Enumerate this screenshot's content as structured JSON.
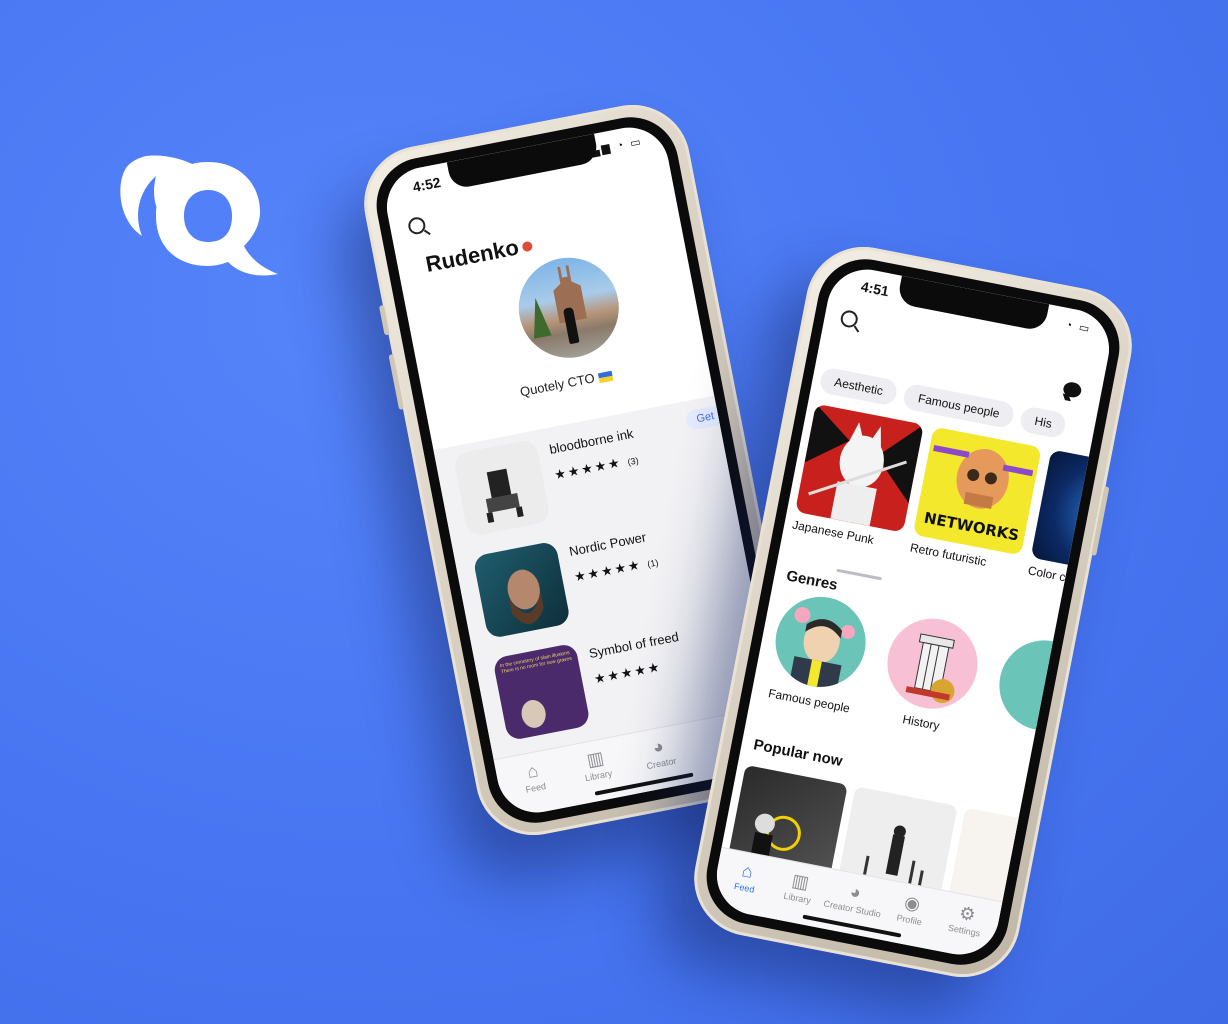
{
  "brand": {
    "logo_letter": "Q",
    "logo_icon": "feather-icon",
    "background_color": "#4a78f5"
  },
  "phone_profile": {
    "status": {
      "time": "4:52"
    },
    "profile": {
      "name": "Rudenko",
      "role": "Quotely CTO"
    },
    "items": [
      {
        "title": "bloodborne ink",
        "stars": "★★★★★",
        "count": "(3)",
        "action": "Get"
      },
      {
        "title": "Nordic Power",
        "stars": "★★★★★",
        "count": "(1)"
      },
      {
        "title": "Symbol of freed",
        "stars": "★★★★★",
        "count": "",
        "thumb_text": "In the cemetery of slain illusions There is no room for new graves"
      }
    ],
    "tabs": [
      {
        "label": "Feed",
        "icon": "home-icon"
      },
      {
        "label": "Library",
        "icon": "book-icon"
      },
      {
        "label": "Creator",
        "icon": "palette-icon"
      }
    ]
  },
  "phone_feed": {
    "status": {
      "time": "4:51"
    },
    "chips": [
      "Aesthetic",
      "Famous people",
      "His"
    ],
    "collections": [
      {
        "caption": "Japanese Punk"
      },
      {
        "caption": "Retro futuristic",
        "art_text": "NETWORKS"
      },
      {
        "caption": "Color c"
      }
    ],
    "genres_title": "Genres",
    "genres": [
      {
        "caption": "Famous people"
      },
      {
        "caption": "History"
      },
      {
        "caption": ""
      }
    ],
    "popular_title": "Popular now",
    "tabs": [
      {
        "label": "Feed",
        "icon": "home-icon",
        "active": true
      },
      {
        "label": "Library",
        "icon": "book-icon"
      },
      {
        "label": "Creator Studio",
        "icon": "palette-icon"
      },
      {
        "label": "Profile",
        "icon": "profile-icon"
      },
      {
        "label": "Settings",
        "icon": "gear-icon"
      }
    ]
  }
}
